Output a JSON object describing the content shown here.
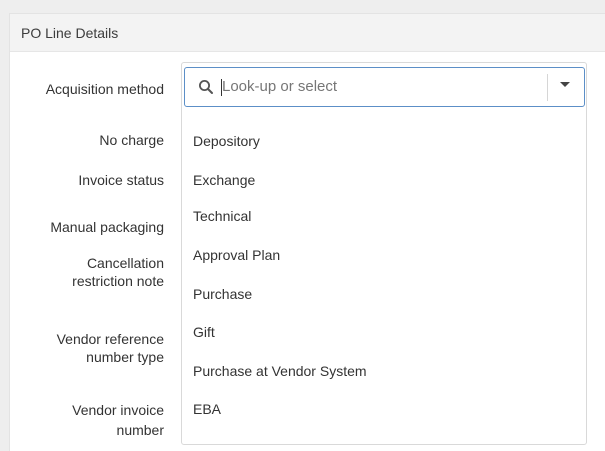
{
  "panel": {
    "title": "PO Line Details"
  },
  "form": {
    "labels": {
      "acquisition_method": "Acquisition method",
      "no_charge": "No charge",
      "invoice_status": "Invoice status",
      "manual_packaging": "Manual packaging",
      "cancellation_line1": "Cancellation",
      "cancellation_line2": "restriction note",
      "vendor_ref_line1": "Vendor reference",
      "vendor_ref_line2": "number type",
      "vendor_invoice_line1": "Vendor invoice",
      "vendor_invoice_line2": "number"
    }
  },
  "lookup": {
    "placeholder": "Look-up or select",
    "search_icon": "search-icon",
    "toggle_icon": "chevron-down-icon"
  },
  "options": [
    "Depository",
    "Exchange",
    "Technical",
    "Approval Plan",
    "Purchase",
    "Gift",
    "Purchase at Vendor System",
    "EBA"
  ],
  "colors": {
    "focus_border": "#5c8fc7",
    "header_bg": "#f3f3f3",
    "text": "#333333"
  }
}
